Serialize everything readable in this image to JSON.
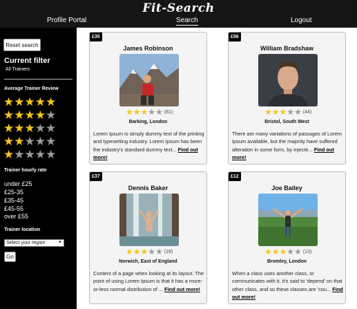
{
  "header": {
    "brand": "Fit-Search",
    "nav": {
      "profile": "Profile Portal",
      "search": "Search",
      "logout": "Logout"
    }
  },
  "sidebar": {
    "reset_label": "Reset search",
    "current_filter_title": "Current filter",
    "current_filter_value": "All Trainers",
    "review_title": "Average Trainer Review",
    "review_levels": [
      5,
      4,
      3,
      2,
      1
    ],
    "rate_title": "Trainer hourly rate",
    "rates": [
      "under £25",
      "£25-35",
      "£35-45",
      "£45-55",
      "over £55"
    ],
    "location_title": "Trainer location",
    "region_placeholder": "Select your region",
    "go_label": "Go"
  },
  "colors": {
    "accent": "#151515",
    "star_on": "#f5c518",
    "star_off": "#9b9b9b"
  },
  "trainers": [
    {
      "price": "£35",
      "name": "James Robinson",
      "rating": 3,
      "reviews": "(81)",
      "location": "Barking, London",
      "description": "Lorem Ipsum is simply dummy text of the printing and typesetting industry. Lorem Ipsum has been the industry's standard dummy text...",
      "more": "Find out more!"
    },
    {
      "price": "£56",
      "name": "William Bradshaw",
      "rating": 3,
      "reviews": "(44)",
      "location": "Bristol, South West",
      "description": "There are many variations of passages of Lorem Ipsum available, but the majority have suffered alteration in some form, by injecte...",
      "more": "Find out more!"
    },
    {
      "price": "£37",
      "name": "Dennis Baker",
      "rating": 3,
      "reviews": "(18)",
      "location": "Norwich, East of England",
      "description": "Content of a page when looking at its layout. The point of using Lorem Ipsum is that it has a more-or-less normal distribution of ...",
      "more": "Find out more!"
    },
    {
      "price": "£12",
      "name": "Joe Bailey",
      "rating": 3,
      "reviews": "(13)",
      "location": "Bromley, London",
      "description": "When a class uses another class, or communicates with it, it's said to 'depend' on that other class, and so these classes are 'cou...",
      "more": "Find out more!"
    }
  ]
}
